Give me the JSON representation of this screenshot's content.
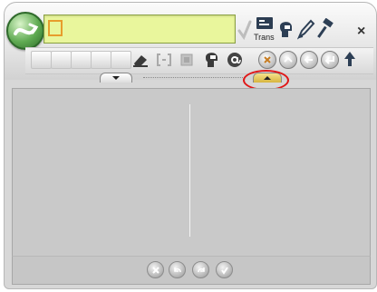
{
  "input": {
    "value": "",
    "placeholder": ""
  },
  "toolbar": {
    "trans_label": "Trans",
    "close_label": "×"
  },
  "colors": {
    "input_bg": "#e9f69c",
    "highlight_oval": "#e01818",
    "panel_bg": "#c9c9c9"
  },
  "icons": {
    "logo": "app-logo-icon",
    "check": "check-icon",
    "trans": "trans-icon",
    "speaker": "speaker-head-icon",
    "pen": "pen-icon",
    "hammer": "hammer-icon",
    "eraser": "eraser-icon",
    "bracket": "bracket-icon",
    "box": "box-icon",
    "head": "head-icon",
    "at": "at-icon",
    "cancel": "cancel-icon",
    "up": "up-arrow-icon",
    "left": "left-arrow-icon",
    "enter": "enter-icon",
    "shift": "shift-up-icon"
  },
  "bottom_buttons": [
    "cancel-icon",
    "undo-icon",
    "redo-icon",
    "accept-icon"
  ]
}
